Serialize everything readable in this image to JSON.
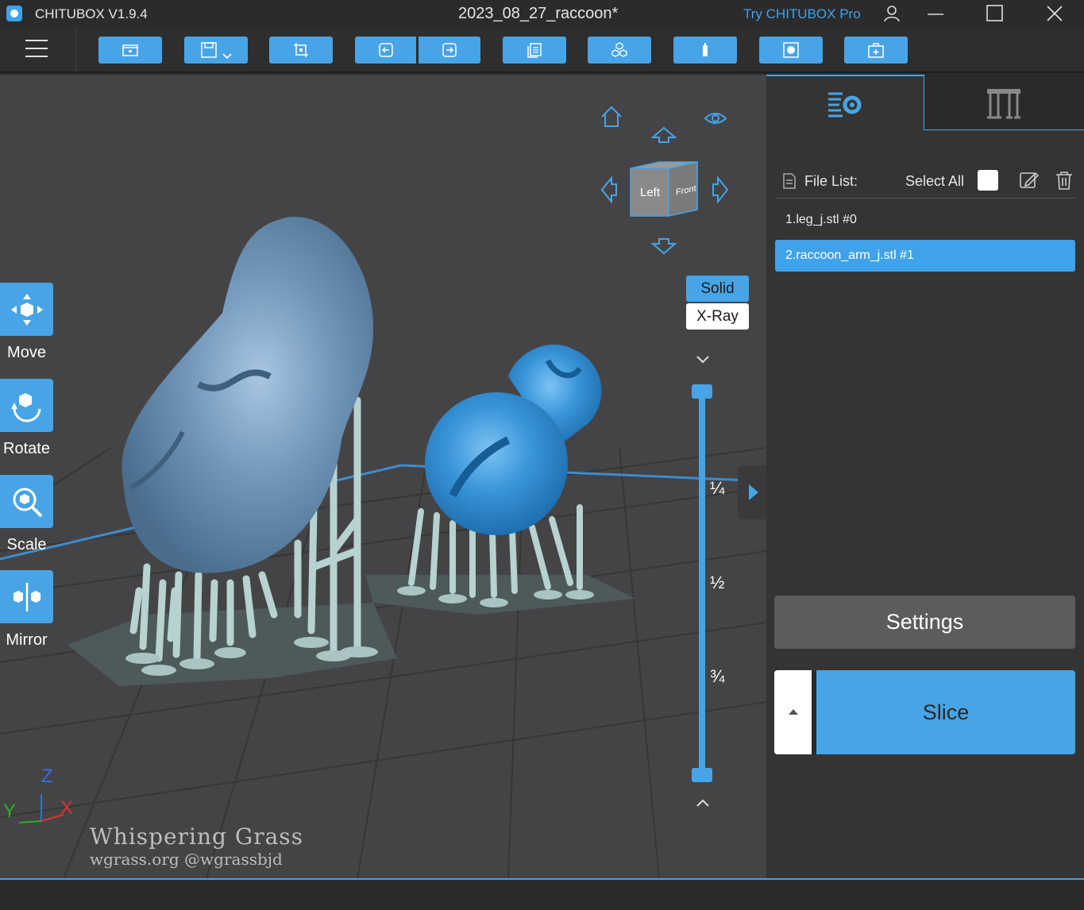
{
  "titlebar": {
    "app_name": "CHITUBOX V1.9.4",
    "document": "2023_08_27_raccoon*",
    "pro_link": "Try CHITUBOX Pro",
    "icons": [
      "user-icon",
      "minimize-icon",
      "maximize-icon",
      "close-icon"
    ]
  },
  "toolbar": {
    "buttons": [
      "open-file-icon",
      "save-icon",
      "auto-layout-icon",
      "undo-icon",
      "redo-icon",
      "copy-icon",
      "array-icon",
      "support-icon",
      "hollow-icon",
      "add-drain-icon"
    ]
  },
  "tools": [
    {
      "label": "Move",
      "icon": "move-icon"
    },
    {
      "label": "Rotate",
      "icon": "rotate-icon"
    },
    {
      "label": "Scale",
      "icon": "scale-icon"
    },
    {
      "label": "Mirror",
      "icon": "mirror-icon"
    }
  ],
  "view_cube": {
    "left_face": "Left",
    "front_face": "Front"
  },
  "render_mode": {
    "solid": "Solid",
    "xray": "X-Ray",
    "selected": "Solid"
  },
  "layer_slider": {
    "marks": [
      "¼",
      "½",
      "¾"
    ],
    "top_value": 1.0,
    "bottom_value": 0.0
  },
  "axes": {
    "z": "Z",
    "y": "Y",
    "x": "X"
  },
  "watermark": {
    "line1": "Whispering Grass",
    "line2": "wgrass.org @wgrassbjd"
  },
  "panel": {
    "file_list_label": "File List:",
    "select_all_label": "Select All",
    "files": [
      {
        "name": "1.leg_j.stl #0",
        "selected": false
      },
      {
        "name": "2.raccoon_arm_j.stl #1",
        "selected": true
      }
    ],
    "settings_label": "Settings",
    "slice_label": "Slice"
  },
  "colors": {
    "accent": "#47a4e6",
    "background": "#2b2b2b",
    "viewport": "#444446"
  }
}
